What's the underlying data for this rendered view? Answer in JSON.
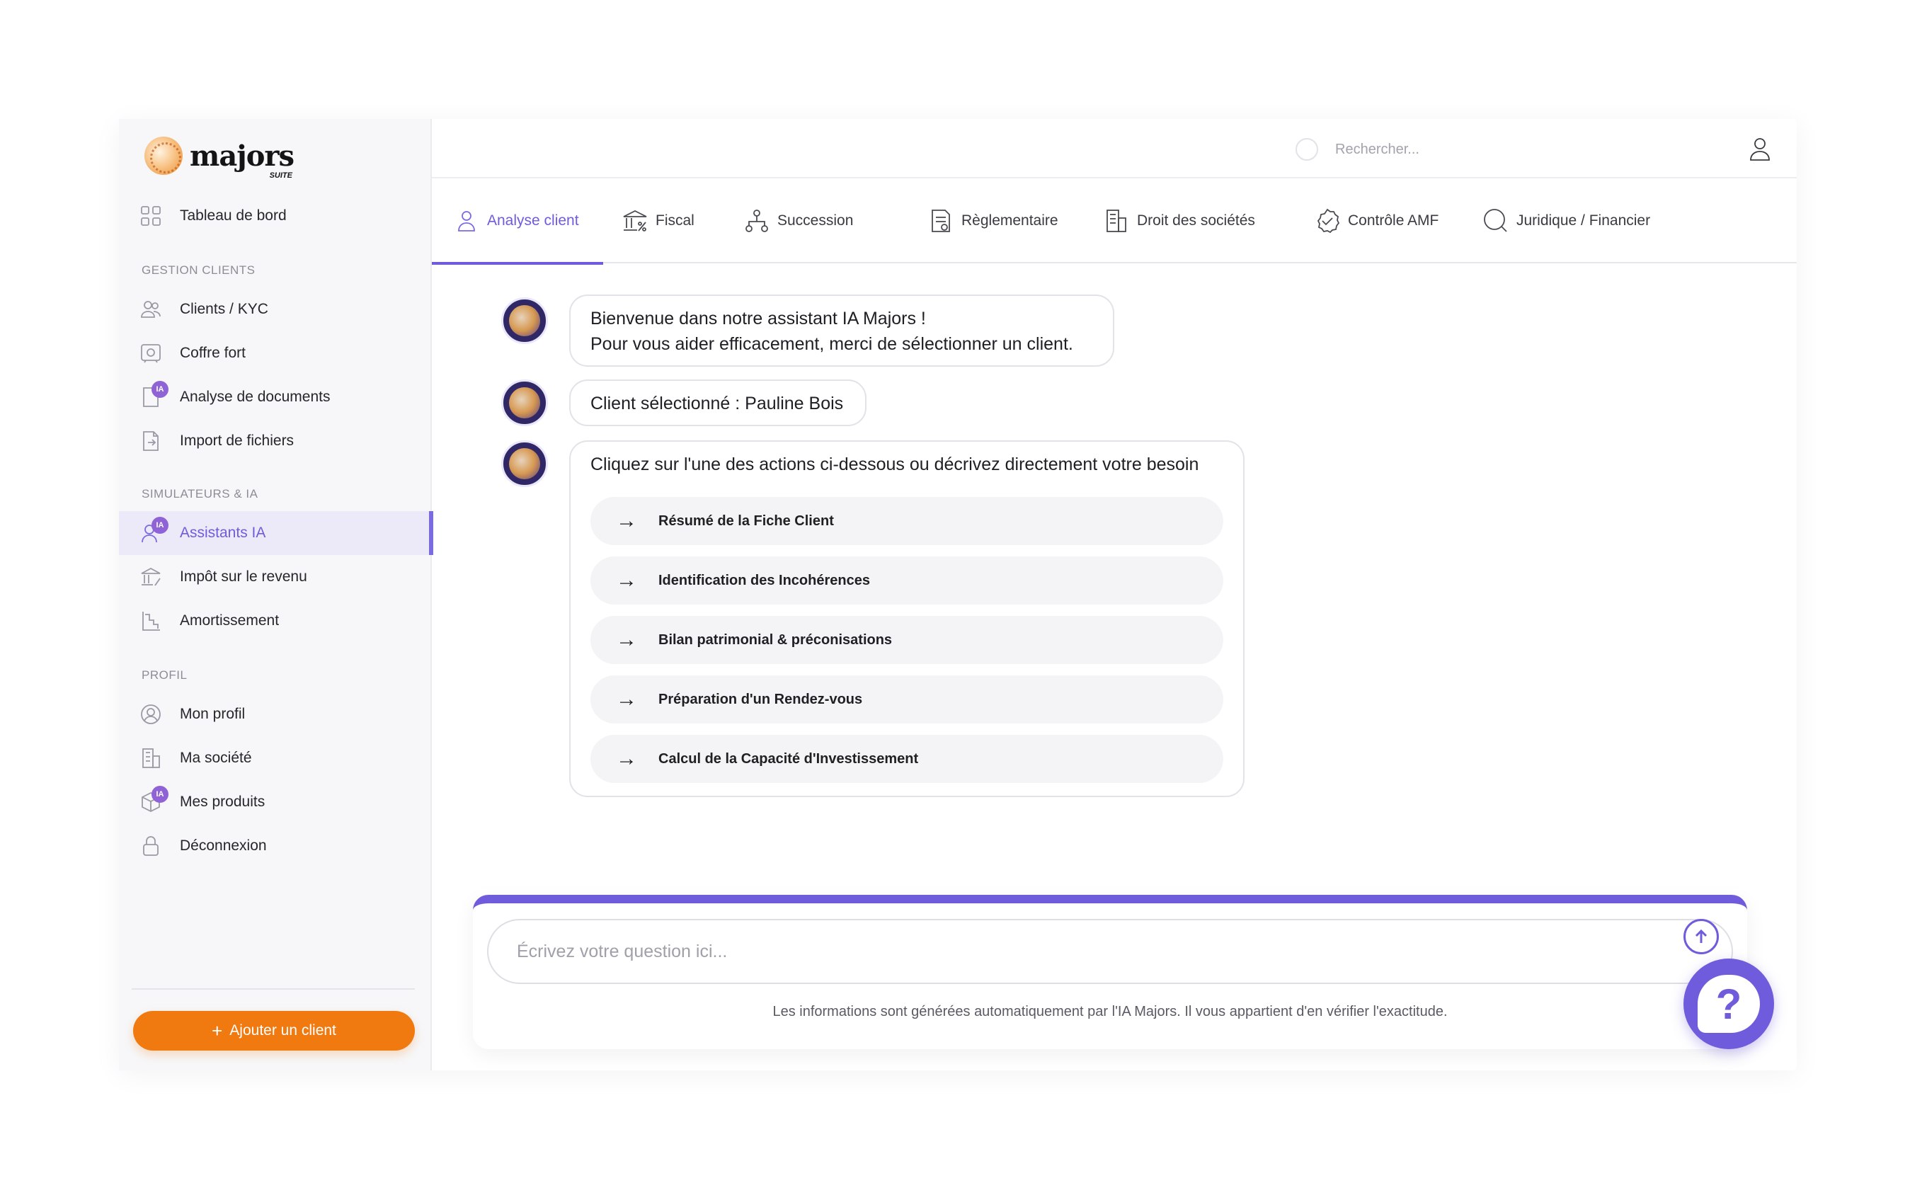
{
  "brand": {
    "name": "majors",
    "sub": "SUITE"
  },
  "sidebar": {
    "dashboard": {
      "label": "Tableau de bord",
      "icon": "grid-icon"
    },
    "sections": [
      {
        "title": "GESTION CLIENTS",
        "items": [
          {
            "label": "Clients / KYC",
            "icon": "users-icon"
          },
          {
            "label": "Coffre fort",
            "icon": "safe-icon"
          },
          {
            "label": "Analyse de documents",
            "icon": "document-analysis-icon",
            "badge": "IA"
          },
          {
            "label": "Import de fichiers",
            "icon": "file-import-icon"
          }
        ]
      },
      {
        "title": "SIMULATEURS & IA",
        "items": [
          {
            "label": "Assistants IA",
            "icon": "assistant-icon",
            "badge": "IA",
            "active": true
          },
          {
            "label": "Impôt sur le revenu",
            "icon": "tax-icon"
          },
          {
            "label": "Amortissement",
            "icon": "chart-icon"
          }
        ]
      },
      {
        "title": "PROFIL",
        "items": [
          {
            "label": "Mon profil",
            "icon": "profile-icon"
          },
          {
            "label": "Ma société",
            "icon": "building-icon"
          },
          {
            "label": "Mes produits",
            "icon": "box-icon",
            "badge": "IA"
          },
          {
            "label": "Déconnexion",
            "icon": "lock-icon"
          }
        ]
      }
    ],
    "add_client": "Ajouter un client"
  },
  "header": {
    "search_placeholder": "Rechercher..."
  },
  "tabs": [
    {
      "label": "Analyse client",
      "icon": "person-icon",
      "active": true
    },
    {
      "label": "Fiscal",
      "icon": "bank-percent-icon"
    },
    {
      "label": "Succession",
      "icon": "hierarchy-icon"
    },
    {
      "label": "Règlementaire",
      "icon": "regulation-icon"
    },
    {
      "label": "Droit des sociétés",
      "icon": "building-icon"
    },
    {
      "label": "Contrôle AMF",
      "icon": "check-badge-icon"
    },
    {
      "label": "Juridique / Financier",
      "icon": "magnifier-icon"
    }
  ],
  "chat": {
    "welcome_line1": "Bienvenue dans notre assistant IA Majors !",
    "welcome_line2": "Pour vous aider efficacement, merci de sélectionner un client.",
    "selected_client": "Client sélectionné : Pauline Bois",
    "prompt": "Cliquez sur l'une des actions ci-dessous ou décrivez directement votre besoin",
    "actions": [
      "Résumé de la Fiche Client",
      "Identification des Incohérences",
      "Bilan patrimonial & préconisations",
      "Préparation d'un Rendez-vous",
      "Calcul de la Capacité d'Investissement"
    ]
  },
  "composer": {
    "placeholder": "Écrivez votre question ici...",
    "disclaimer": "Les informations sont générées automatiquement par l'IA Majors. Il vous appartient d'en vérifier l'exactitude."
  },
  "colors": {
    "accent": "#6f5cdc",
    "orange": "#f07a10",
    "badge": "#8f63d6"
  }
}
